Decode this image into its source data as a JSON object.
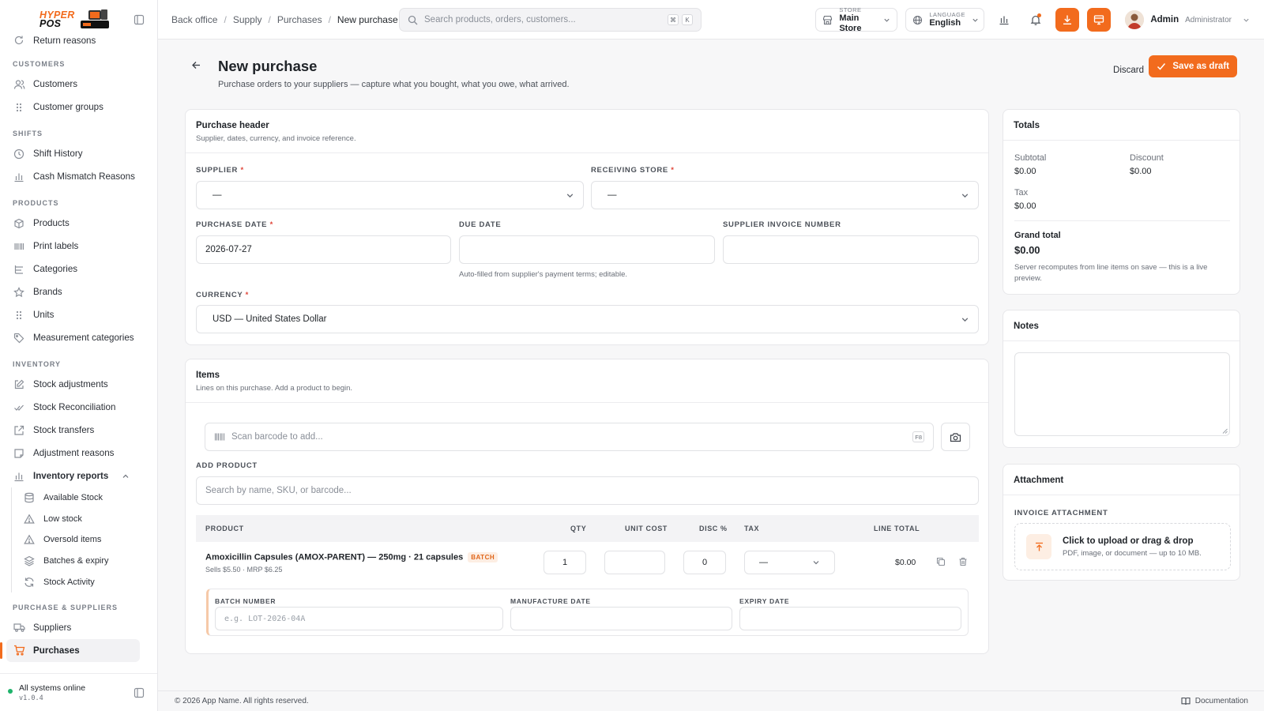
{
  "logo": {
    "line1": "HYPER",
    "line2": "POS"
  },
  "sidebar": {
    "partial_item": "Return reasons",
    "sections": {
      "customers": "CUSTOMERS",
      "shifts": "SHIFTS",
      "products": "PRODUCTS",
      "inventory": "INVENTORY",
      "purchase_suppliers": "PURCHASE & SUPPLIERS"
    },
    "customers": [
      "Customers",
      "Customer groups"
    ],
    "shifts": [
      "Shift History",
      "Cash Mismatch Reasons"
    ],
    "products": [
      "Products",
      "Print labels",
      "Categories",
      "Brands",
      "Units",
      "Measurement categories"
    ],
    "inventory": [
      "Stock adjustments",
      "Stock Reconciliation",
      "Stock transfers",
      "Adjustment reasons"
    ],
    "inventory_reports": "Inventory reports",
    "inventory_reports_children": [
      "Available Stock",
      "Low stock",
      "Oversold items",
      "Batches & expiry",
      "Stock Activity"
    ],
    "purchase": [
      "Suppliers",
      "Purchases"
    ],
    "footer_status": "All systems online",
    "footer_version": "v1.0.4"
  },
  "topbar": {
    "breadcrumb": [
      "Back office",
      "Supply",
      "Purchases",
      "New purchase"
    ],
    "search_placeholder": "Search products, orders, customers...",
    "kbd1": "⌘",
    "kbd2": "K",
    "store_label": "STORE",
    "store_value": "Main Store",
    "language_label": "LANGUAGE",
    "language_value": "English",
    "user_name": "Admin",
    "user_role": "Administrator"
  },
  "page": {
    "title": "New purchase",
    "subtitle": "Purchase orders to your suppliers — capture what you bought, what you owe, what arrived.",
    "discard": "Discard",
    "save": "Save as draft"
  },
  "header_card": {
    "title": "Purchase header",
    "desc": "Supplier, dates, currency, and invoice reference.",
    "supplier_label": "SUPPLIER",
    "supplier_value": "—",
    "store_label": "RECEIVING STORE",
    "store_value": "—",
    "purchase_date_label": "PURCHASE DATE",
    "purchase_date_value": "2026-07-27",
    "due_date_label": "DUE DATE",
    "due_date_value": "",
    "due_hint": "Auto-filled from supplier's payment terms; editable.",
    "invoice_label": "SUPPLIER INVOICE NUMBER",
    "invoice_value": "",
    "currency_label": "CURRENCY",
    "currency_value": "USD — United States Dollar",
    "required_mark": "*"
  },
  "items_card": {
    "title": "Items",
    "desc": "Lines on this purchase. Add a product to begin.",
    "scan_placeholder": "Scan barcode to add...",
    "scan_kbd": "F8",
    "add_product_label": "ADD PRODUCT",
    "add_product_placeholder": "Search by name, SKU, or barcode...",
    "columns": [
      "PRODUCT",
      "QTY",
      "UNIT COST",
      "DISC %",
      "TAX",
      "LINE TOTAL"
    ],
    "row": {
      "name": "Amoxicillin Capsules (AMOX-PARENT) — 250mg · 21 capsules",
      "badge": "BATCH",
      "meta": "Sells $5.50 · MRP $6.25",
      "qty": "1",
      "unit_cost": "",
      "disc": "0",
      "tax": "—",
      "line_total": "$0.00"
    },
    "batch_label": "BATCH NUMBER",
    "batch_placeholder": "e.g. LOT-2026-04A",
    "mfg_label": "MANUFACTURE DATE",
    "exp_label": "EXPIRY DATE"
  },
  "totals": {
    "title": "Totals",
    "subtotal_label": "Subtotal",
    "subtotal": "$0.00",
    "discount_label": "Discount",
    "discount": "$0.00",
    "tax_label": "Tax",
    "tax": "$0.00",
    "grand_label": "Grand total",
    "grand": "$0.00",
    "note": "Server recomputes from line items on save — this is a live preview."
  },
  "notes": {
    "title": "Notes",
    "value": ""
  },
  "attachment": {
    "title": "Attachment",
    "label": "INVOICE ATTACHMENT",
    "upload_title": "Click to upload or drag & drop",
    "upload_hint": "PDF, image, or document — up to 10 MB."
  },
  "footer": {
    "copyright": "© 2026 App Name. All rights reserved.",
    "docs": "Documentation"
  },
  "colors": {
    "accent": "#f26b1d",
    "success": "#1fb36b",
    "required": "#e0463a"
  }
}
